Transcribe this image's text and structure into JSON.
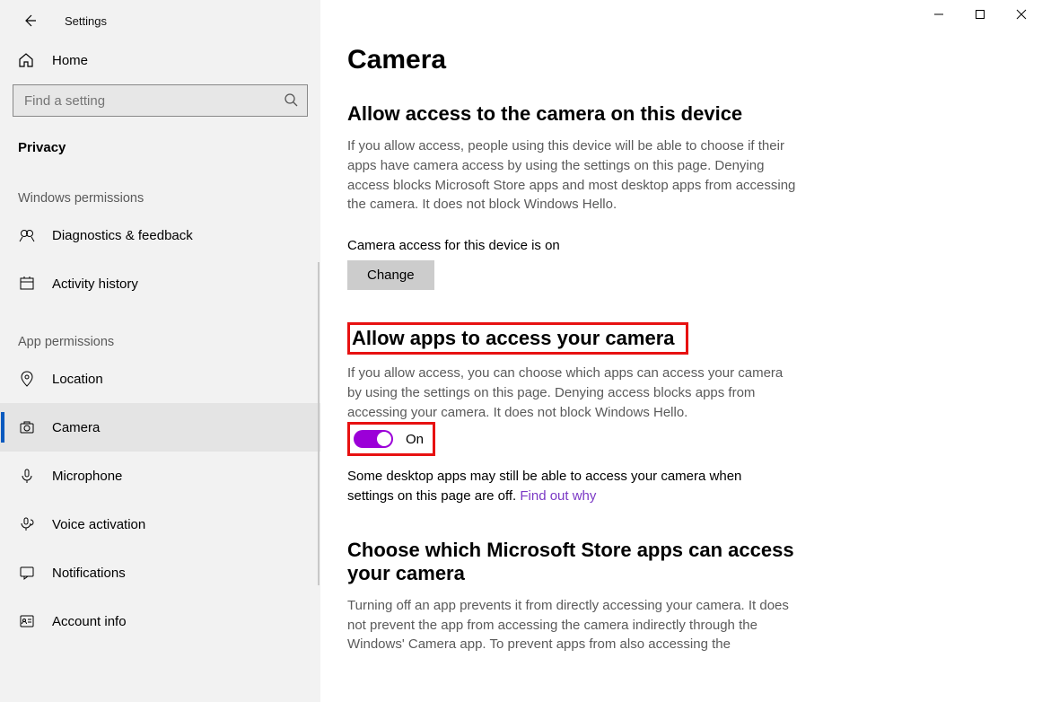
{
  "app_title": "Settings",
  "home_label": "Home",
  "search_placeholder": "Find a setting",
  "category_label": "Privacy",
  "sections": {
    "windows_permissions": "Windows permissions",
    "app_permissions": "App permissions"
  },
  "nav": {
    "diagnostics": "Diagnostics & feedback",
    "activity_history": "Activity history",
    "location": "Location",
    "camera": "Camera",
    "microphone": "Microphone",
    "voice_activation": "Voice activation",
    "notifications": "Notifications",
    "account_info": "Account info"
  },
  "page": {
    "title": "Camera",
    "sec1_title": "Allow access to the camera on this device",
    "sec1_desc": "If you allow access, people using this device will be able to choose if their apps have camera access by using the settings on this page. Denying access blocks Microsoft Store apps and most desktop apps from accessing the camera. It does not block Windows Hello.",
    "status_line": "Camera access for this device is on",
    "change_btn": "Change",
    "sec2_title": "Allow apps to access your camera",
    "sec2_desc": "If you allow access, you can choose which apps can access your camera by using the settings on this page. Denying access blocks apps from accessing your camera. It does not block Windows Hello.",
    "toggle_state": "On",
    "desktop_note_1": "Some desktop apps may still be able to access your camera when settings on this page are off. ",
    "find_out_why": "Find out why",
    "sec3_title": "Choose which Microsoft Store apps can access your camera",
    "sec3_desc": "Turning off an app prevents it from directly accessing your camera. It does not prevent the app from accessing the camera indirectly through the Windows' Camera app. To prevent apps from also accessing the"
  }
}
